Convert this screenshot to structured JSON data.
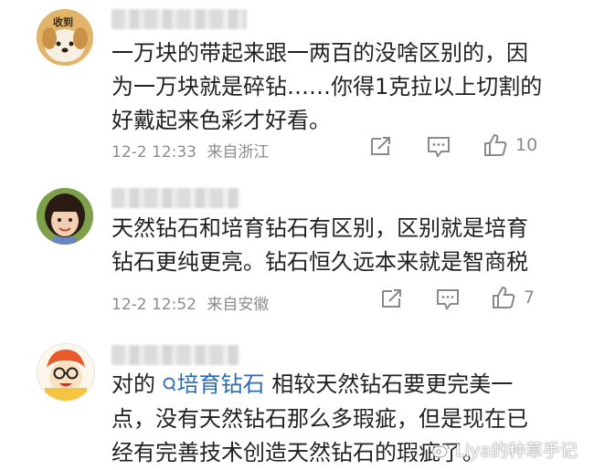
{
  "comments": [
    {
      "lines": [
        "一万块的带起来跟一两百的没啥区别的，因",
        "为一万块就是碎钻……你得1克拉以上切割的",
        "好戴起来色彩才好看。"
      ],
      "time": "12-2 12:33",
      "location": "来自浙江",
      "likes": "10",
      "avatar_icon": "dog-avatar-icon",
      "avatar_caption": "收到"
    },
    {
      "lines": [
        "天然钻石和培育钻石有区别，区别就是培育",
        "钻石更纯更亮。钻石恒久远本来就是智商税"
      ],
      "time": "12-2 12:52",
      "location": "来自安徽",
      "likes": "7",
      "avatar_icon": "girl-avatar-icon"
    },
    {
      "line1_prefix": "对的 ",
      "topic_link": "培育钻石",
      "line1_suffix": " 相较天然钻石要更完美一",
      "lines": [
        "点，没有天然钻石那么多瑕疵，但是现在已",
        "经有完善技术创造天然钻石的瑕疵了。"
      ],
      "avatar_icon": "cartoon-avatar-icon"
    }
  ],
  "watermark": "Liya的种草手记",
  "colors": {
    "topic_link": "#2a6bb5",
    "meta_text": "#8c8c8c",
    "icon": "#8a8a8a"
  }
}
